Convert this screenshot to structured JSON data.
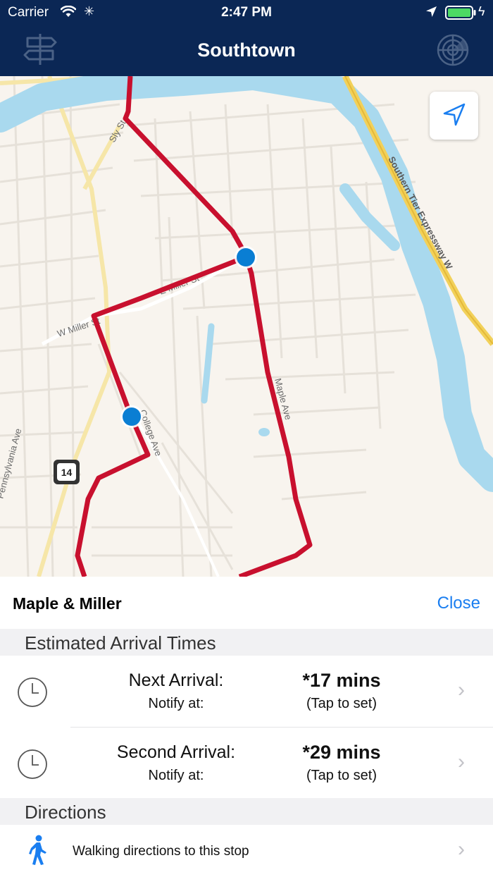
{
  "status_bar": {
    "carrier": "Carrier",
    "time": "2:47 PM"
  },
  "nav": {
    "title": "Southtown"
  },
  "map": {
    "labels": {
      "road_sly": "Sly St",
      "road_w_miller": "W Miller St",
      "road_e_miller": "E Miller St",
      "road_pennsylvania": "Pennsylvania Ave",
      "road_expressway": "Southern Tier Expressway W",
      "road_maple": "Maple Ave",
      "road_college": "College Ave",
      "route_shield": "14"
    },
    "colors": {
      "route": "#c8102e",
      "stop": "#0a7ed3",
      "water": "#a9d9ee",
      "land": "#f8f4ee",
      "highway": "#f2d15a"
    }
  },
  "sheet": {
    "stop_name": "Maple & Miller",
    "close_label": "Close",
    "arrivals_header": "Estimated Arrival Times",
    "arrivals": [
      {
        "label": "Next Arrival:",
        "notify_label": "Notify at:",
        "time": "*17 mins",
        "notify_value": "(Tap to set)"
      },
      {
        "label": "Second Arrival:",
        "notify_label": "Notify at:",
        "time": "*29 mins",
        "notify_value": "(Tap to set)"
      }
    ],
    "directions_header": "Directions",
    "walking_label": "Walking directions to this stop"
  },
  "icons": {
    "signpost": "signpost-icon",
    "radar": "radar-icon",
    "locate": "location-arrow-icon",
    "clock": "clock-icon",
    "walker": "walking-person-icon",
    "chevron": "chevron-right-icon"
  }
}
